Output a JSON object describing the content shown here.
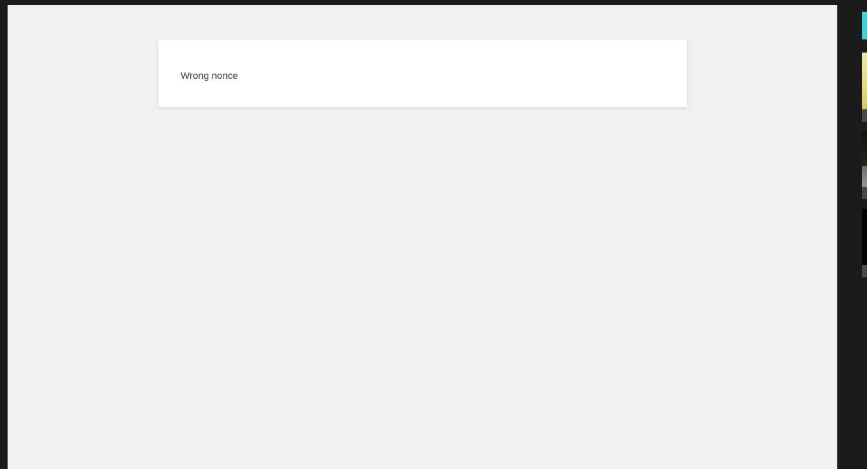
{
  "notice": {
    "message": "Wrong nonce"
  },
  "thumbnails": [
    {
      "icon": "thumbnail-cyan",
      "color": "#3fd3dc"
    },
    {
      "icon": "thumbnail-yellow",
      "color": "#e6d97a"
    },
    {
      "icon": "thumbnail-dark",
      "color": "#101408"
    },
    {
      "icon": "thumbnail-black",
      "color": "#000000"
    }
  ],
  "colors": {
    "page_background": "#f0f0f0",
    "outer_background": "#1b1b1b",
    "card_background": "#ffffff",
    "text": "#444444"
  }
}
